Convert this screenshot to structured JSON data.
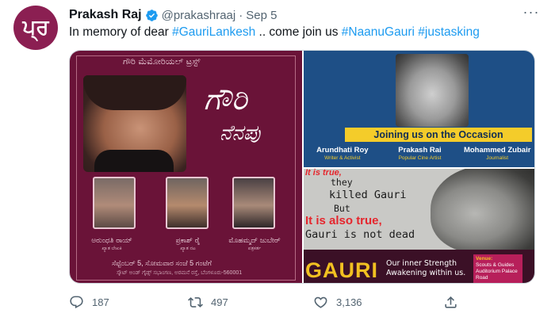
{
  "tweet": {
    "avatar_glyph": "ਪ੍ਰ",
    "name": "Prakash Raj",
    "handle": "@prakashraaj",
    "separator": "·",
    "date": "Sep 5",
    "more": "···",
    "text": {
      "prefix": "In memory of dear ",
      "tag1": "#GauriLankesh",
      "middle": " .. come join us ",
      "tag2": "#NaanuGauri",
      "space": " ",
      "tag3": "#justasking"
    }
  },
  "media": {
    "left_poster": {
      "top_line": "ಗೌರಿ ಮೆಮೋರಿಯಲ್ ಟ್ರಸ್ಟ್",
      "title_line1": "ಗೌರಿ",
      "title_line2": "ನೆನಪು",
      "speakers": [
        {
          "name": "ಅರುಂಧತಿ ರಾಯ್",
          "role": "ಖ್ಯಾತ ಲೇಖಕಿ"
        },
        {
          "name": "ಪ್ರಕಾಶ್ ರೈ",
          "role": "ಖ್ಯಾತ ನಟ"
        },
        {
          "name": "ಮೊಹಮ್ಮದ್ ಜುಬೇರ್",
          "role": "ಪತ್ರಕರ್ತ"
        }
      ],
      "footer1": "ಸೆಪ್ಟೆಂಬರ್ 5, ಸೋಮವಾರ ಸಂಜೆ 5 ಗಂಟೆಗೆ",
      "footer2": "ಸ್ಕೌಟ್ ಅಂಡ್ ಗೈಡ್ಸ್ ಸಭಾಂಗಣ, ಅರಮನೆ ರಸ್ತೆ, ಬೆಂಗಳೂರು-560001"
    },
    "top_right": {
      "banner": "Joining us on the Occasion",
      "people": [
        {
          "name": "Arundhati Roy",
          "role": "Writer & Activist"
        },
        {
          "name": "Prakash Rai",
          "role": "Popular Cine Artist"
        },
        {
          "name": "Mohammed Zubair",
          "role": "Journalist"
        }
      ]
    },
    "bottom_right": {
      "line1": "It is true,",
      "line2": "they",
      "line3": "killed Gauri",
      "line4": "But",
      "line5": "It is also true,",
      "line6": "Gauri is not dead",
      "brand": "GAURI",
      "tag1": "Our inner Strength",
      "tag2": "Awakening within us.",
      "venue_head": "Venue:",
      "venue_body": "Scouts & Guides Auditorium Palace Road"
    }
  },
  "actions": {
    "replies": "187",
    "retweets": "497",
    "likes": "3,136"
  },
  "colors": {
    "link": "#1d9bf0",
    "muted": "#536471",
    "verified": "#1d9bf0",
    "avatar_bg": "#8b1f52"
  }
}
